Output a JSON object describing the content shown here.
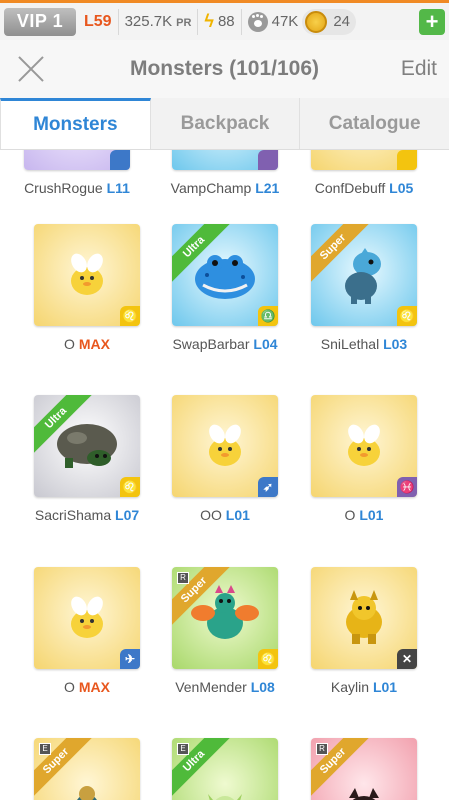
{
  "statbar": {
    "vip": "VIP 1",
    "level": "L59",
    "power": "325.7K",
    "power_unit": "PR",
    "energy": "88",
    "food": "47K",
    "coins": "24",
    "add_label": "+"
  },
  "header": {
    "title": "Monsters (101/106)",
    "edit_label": "Edit"
  },
  "tabs": [
    {
      "label": "Monsters"
    },
    {
      "label": "Backpack"
    },
    {
      "label": "Catalogue"
    }
  ],
  "monsters": [
    {
      "name": "CrushRogue",
      "level": "L11"
    },
    {
      "name": "VampChamp",
      "level": "L21"
    },
    {
      "name": "ConfDebuff",
      "level": "L05"
    },
    {
      "name": "O",
      "level": "MAX"
    },
    {
      "name": "SwapBarbar",
      "level": "L04",
      "ribbon": "Ultra",
      "element": "♎"
    },
    {
      "name": "SniLethal",
      "level": "L03",
      "ribbon": "Super",
      "element": "♌"
    },
    {
      "name": "SacriShama",
      "level": "L07",
      "ribbon": "Ultra",
      "element": "♌"
    },
    {
      "name": "OO",
      "level": "L01",
      "element": "➶"
    },
    {
      "name": "O",
      "level": "L01",
      "element": "♓"
    },
    {
      "name": "O",
      "level": "MAX",
      "element": "✈"
    },
    {
      "name": "VenMender",
      "level": "L08",
      "ribbon": "Super",
      "tag": "R",
      "element": "♌"
    },
    {
      "name": "Kaylin",
      "level": "L01",
      "element": "✕"
    },
    {
      "ribbon": "Super",
      "tag": "E"
    },
    {
      "ribbon": "Ultra",
      "tag": "E"
    },
    {
      "ribbon": "Super",
      "tag": "R"
    }
  ],
  "first_element": "♌",
  "colors": {
    "accent": "#2f86d6",
    "max": "#e8571e",
    "level_header": "#e8571e"
  }
}
